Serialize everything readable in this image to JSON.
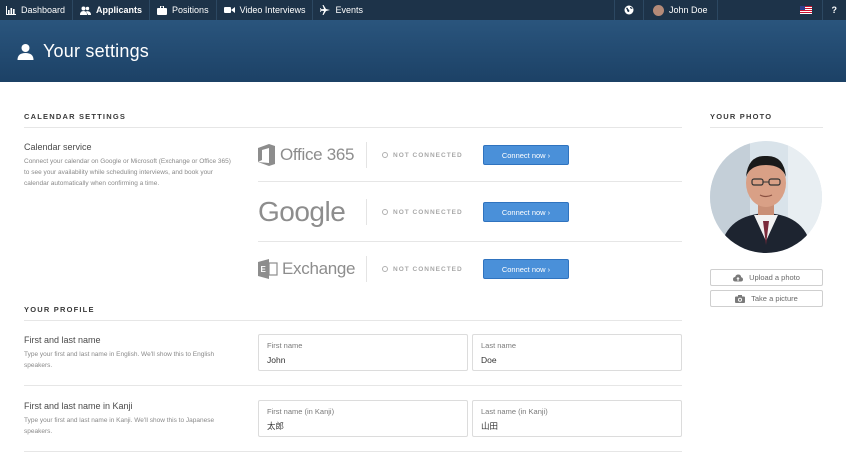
{
  "nav": {
    "items": [
      {
        "label": "Dashboard",
        "icon": "chart-icon"
      },
      {
        "label": "Applicants",
        "icon": "users-icon"
      },
      {
        "label": "Positions",
        "icon": "briefcase-icon"
      },
      {
        "label": "Video Interviews",
        "icon": "video-camera-icon"
      },
      {
        "label": "Events",
        "icon": "plane-icon"
      }
    ],
    "user_name": "John Doe",
    "help": "?"
  },
  "header": {
    "title": "Your settings"
  },
  "calendar": {
    "section_title": "CALENDAR SETTINGS",
    "service_label": "Calendar service",
    "service_desc": "Connect your calendar on Google or Microsoft (Exchange or Office 365) to see your availability while scheduling interviews, and book your calendar automatically when confirming a time.",
    "providers": [
      {
        "name": "Office 365",
        "status": "NOT CONNECTED",
        "button": "Connect now ›"
      },
      {
        "name": "Google",
        "status": "NOT CONNECTED",
        "button": "Connect now ›"
      },
      {
        "name": "Exchange",
        "status": "NOT CONNECTED",
        "button": "Connect now ›"
      }
    ]
  },
  "profile": {
    "section_title": "YOUR PROFILE",
    "name_label": "First and last name",
    "name_desc": "Type your first and last name in English. We'll show this to English speakers.",
    "first_name_label": "First name",
    "first_name_value": "John",
    "last_name_label": "Last name",
    "last_name_value": "Doe",
    "kanji_label": "First and last name in Kanji",
    "kanji_desc": "Type your first and last name in Kanji. We'll show this to Japanese speakers.",
    "first_kanji_label": "First name (in Kanji)",
    "first_kanji_value": "太郎",
    "last_kanji_label": "Last name (in Kanji)",
    "last_kanji_value": "山田"
  },
  "photo": {
    "section_title": "YOUR PHOTO",
    "upload_label": "Upload a photo",
    "take_label": "Take a picture"
  },
  "colors": {
    "nav_bg": "#1d3349",
    "banner": "#234b73",
    "accent": "#4a90d9"
  }
}
